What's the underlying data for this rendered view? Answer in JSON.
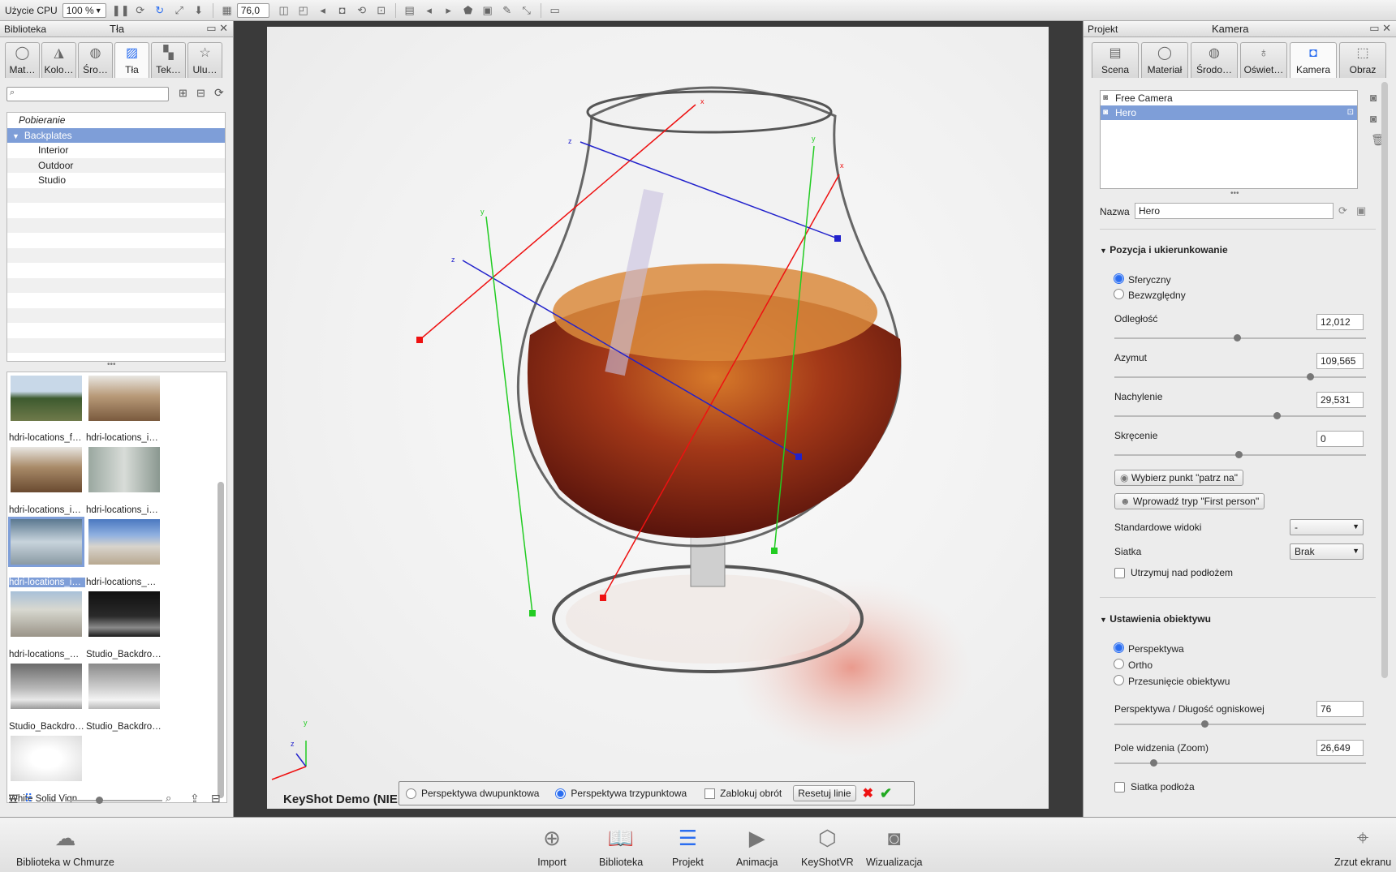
{
  "toolbar": {
    "cpu_label": "Użycie CPU",
    "zoom_value": "100 %",
    "value_field": "76,0"
  },
  "left": {
    "library_title": "Biblioteka",
    "panel_title": "Tła",
    "tabs": [
      "Mat…",
      "Kolo…",
      "Śro…",
      "Tła",
      "Tek…",
      "Ulu…"
    ],
    "tree": [
      "Pobieranie",
      "Backplates",
      "Interior",
      "Outdoor",
      "Studio"
    ],
    "thumbs": [
      "hdri-locations_f…",
      "hdri-locations_i…",
      "hdri-locations_i…",
      "hdri-locations_i…",
      "hdri-locations_i…",
      "hdri-locations_…",
      "hdri-locations_…",
      "Studio_Backdro…",
      "Studio_Backdro…",
      "Studio_Backdro…",
      "White Solid Vign…"
    ]
  },
  "viewport": {
    "watermark": "KeyShot Demo (NIE DO UŻYTKU KOMERCYJNEGO)",
    "opt_two_point": "Perspektywa dwupunktowa",
    "opt_three_point": "Perspektywa trzypunktowa",
    "lock_rotation": "Zablokuj obrót",
    "reset_lines": "Resetuj linie",
    "axis_x": "x",
    "axis_y": "y",
    "axis_z": "z"
  },
  "right": {
    "project_title": "Projekt",
    "panel_title": "Kamera",
    "tabs": [
      "Scena",
      "Materiał",
      "Środo…",
      "Oświet…",
      "Kamera",
      "Obraz"
    ],
    "cameras": [
      "Free Camera",
      "Hero"
    ],
    "name_label": "Nazwa",
    "name_value": "Hero",
    "section_position": "Pozycja i ukierunkowanie",
    "radio_spherical": "Sferyczny",
    "radio_absolute": "Bezwzględny",
    "distance_label": "Odległość",
    "distance_value": "12,012",
    "azimuth_label": "Azymut",
    "azimuth_value": "109,565",
    "incline_label": "Nachylenie",
    "incline_value": "29,531",
    "twist_label": "Skręcenie",
    "twist_value": "0",
    "btn_lookat": "Wybierz punkt \"patrz na\"",
    "btn_firstperson": "Wprowadź tryp \"First person\"",
    "std_views_label": "Standardowe widoki",
    "std_views_value": "-",
    "grid_label": "Siatka",
    "grid_value": "Brak",
    "keep_above": "Utrzymuj nad podłożem",
    "section_lens": "Ustawienia obiektywu",
    "radio_perspective": "Perspektywa",
    "radio_ortho": "Ortho",
    "radio_shift": "Przesunięcie obiektywu",
    "focal_label": "Perspektywa / Długość ogniskowej",
    "focal_value": "76",
    "fov_label": "Pole widzenia (Zoom)",
    "fov_value": "26,649",
    "floor_grid": "Siatka podłoża"
  },
  "bottom": {
    "cloud": "Biblioteka w Chmurze",
    "import": "Import",
    "library": "Biblioteka",
    "project": "Projekt",
    "animation": "Animacja",
    "keyshotvr": "KeyShotVR",
    "render": "Wizualizacja",
    "screenshot": "Zrzut ekranu"
  }
}
